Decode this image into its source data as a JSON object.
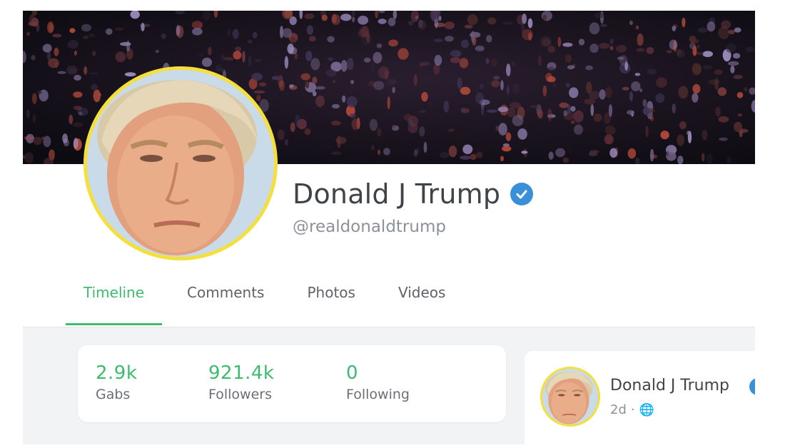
{
  "profile": {
    "display_name": "Donald J Trump",
    "handle": "@realdonaldtrump",
    "verified_icon": "verified-checkmark-icon"
  },
  "tabs": [
    {
      "label": "Timeline",
      "active": true
    },
    {
      "label": "Comments",
      "active": false
    },
    {
      "label": "Photos",
      "active": false
    },
    {
      "label": "Videos",
      "active": false
    }
  ],
  "stats": [
    {
      "value": "2.9k",
      "label": "Gabs"
    },
    {
      "value": "921.4k",
      "label": "Followers"
    },
    {
      "value": "0",
      "label": "Following"
    }
  ],
  "post": {
    "author": "Donald J Trump",
    "time": "2d",
    "separator": "·",
    "visibility_icon": "globe-icon"
  },
  "colors": {
    "accent_green": "#3dbb6e",
    "verified_blue": "#3a8fd9",
    "avatar_ring": "#f4df3c"
  }
}
